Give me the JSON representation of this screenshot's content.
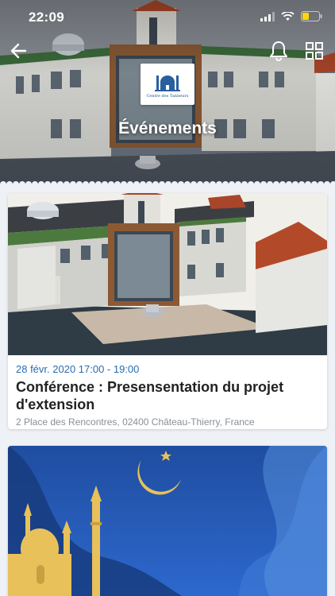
{
  "status_bar": {
    "time": "22:09"
  },
  "header": {
    "title": "Événements",
    "logo_text": "Centre des Tanneurs"
  },
  "events": [
    {
      "date": "28 févr. 2020 17:00 - 19:00",
      "title": "Conférence : Presensentation du projet d'extension",
      "address": "2 Place des Rencontres, 02400 Château-Thierry, France"
    }
  ],
  "colors": {
    "accent": "#2a6cb0",
    "background": "#eef1f5",
    "night_sky": "#1b3f7a",
    "gold": "#e8c15a"
  },
  "icons": [
    "back-arrow-icon",
    "bell-icon",
    "grid-icon",
    "signal-icon",
    "wifi-icon",
    "battery-icon"
  ]
}
